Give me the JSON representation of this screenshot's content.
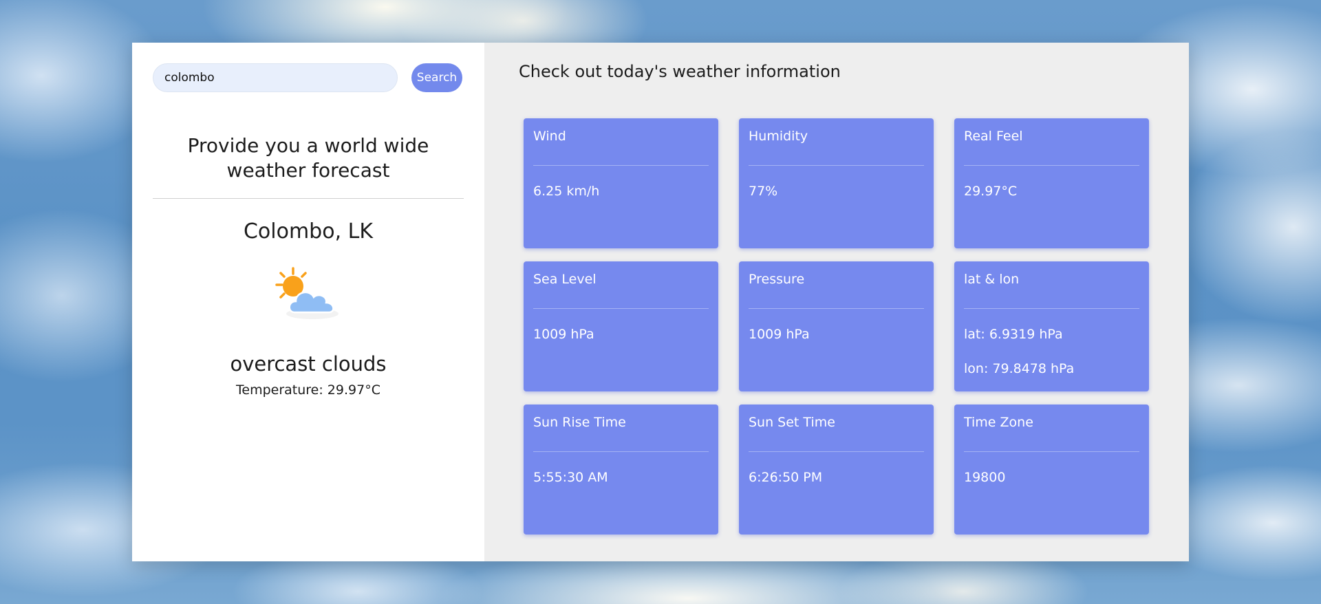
{
  "search": {
    "value": "colombo",
    "button_label": "Search"
  },
  "sidebar": {
    "tagline": "Provide you a world wide weather forecast",
    "city": "Colombo, LK",
    "weather_icon": "sun-behind-cloud-icon",
    "description": "overcast clouds",
    "temperature": "Temperature: 29.97°C"
  },
  "main": {
    "title": "Check out today's weather information",
    "tiles": [
      {
        "label": "Wind",
        "value": "6.25 km/h"
      },
      {
        "label": "Humidity",
        "value": "77%"
      },
      {
        "label": "Real Feel",
        "value": "29.97°C"
      },
      {
        "label": "Sea Level",
        "value": "1009 hPa"
      },
      {
        "label": "Pressure",
        "value": "1009 hPa"
      },
      {
        "label": "lat & lon",
        "value": "lat: 6.9319 hPa",
        "value2": "lon: 79.8478 hPa"
      },
      {
        "label": "Sun Rise Time",
        "value": "5:55:30 AM"
      },
      {
        "label": "Sun Set Time",
        "value": "6:26:50 PM"
      },
      {
        "label": "Time Zone",
        "value": "19800"
      }
    ]
  },
  "colors": {
    "accent": "#7389ec",
    "tile_background": "#7689ee",
    "sun": "#f9a11b",
    "cloud": "#8fbdf4"
  }
}
